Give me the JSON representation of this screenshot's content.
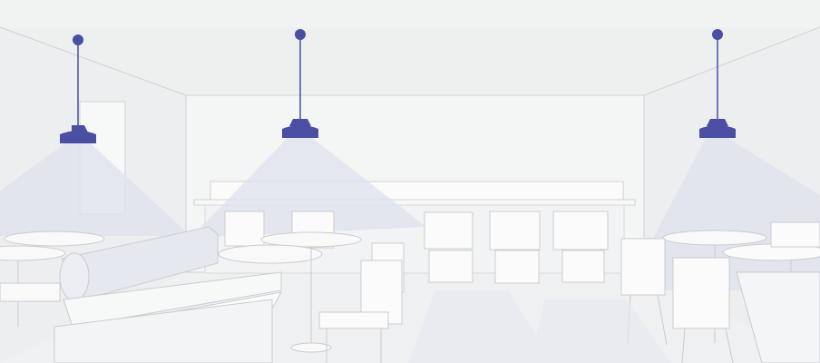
{
  "scene": {
    "subject": "restaurant-interior-line-illustration",
    "colors": {
      "wall": "#f2f3f3",
      "ceiling": "#eeeff0",
      "line": "#cfd2d5",
      "lamp": "#4a4fa3",
      "light_cone": "#dfe2ee",
      "furniture": "#fafafa"
    },
    "lamps": [
      {
        "name": "pendant-lamp-left"
      },
      {
        "name": "pendant-lamp-center"
      },
      {
        "name": "pendant-lamp-right"
      }
    ]
  }
}
